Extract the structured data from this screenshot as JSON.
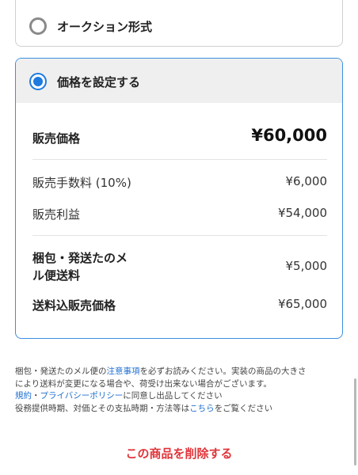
{
  "options": {
    "auction_label": "オークション形式",
    "fixed_price_label": "価格を設定する"
  },
  "price": {
    "sale_price_label": "販売価格",
    "sale_price_value": "¥60,000",
    "fee_label": "販売手数料 (10%)",
    "fee_value": "¥6,000",
    "profit_label": "販売利益",
    "profit_value": "¥54,000",
    "shipping_label_line1": "梱包・発送たのメ",
    "shipping_label_line2": "ル便送料",
    "shipping_value": "¥5,000",
    "total_label": "送料込販売価格",
    "total_value": "¥65,000"
  },
  "notes": {
    "line1_pre": "梱包・発送たのメル便の",
    "line1_link": "注意事項",
    "line1_post": "を必ずお読みください。実装の商品の大きさ",
    "line2": "により送料が変更になる場合や、荷受け出来ない場合がございます。",
    "terms_link": "規約",
    "separator": "・",
    "privacy_link": "プライバシーポリシー",
    "line3_post": "に同意し出品してください",
    "line4_pre": "役務提供時期、対価とその支払時期・方法等は",
    "here_link": "こちら",
    "line4_post": "をご覧ください"
  },
  "delete_label": "この商品を削除する",
  "colors": {
    "accent_blue": "#1f7ae0",
    "card_border_selected": "#3d8fe0",
    "delete_red": "#e0343a",
    "link_blue": "#1f6fd0"
  }
}
